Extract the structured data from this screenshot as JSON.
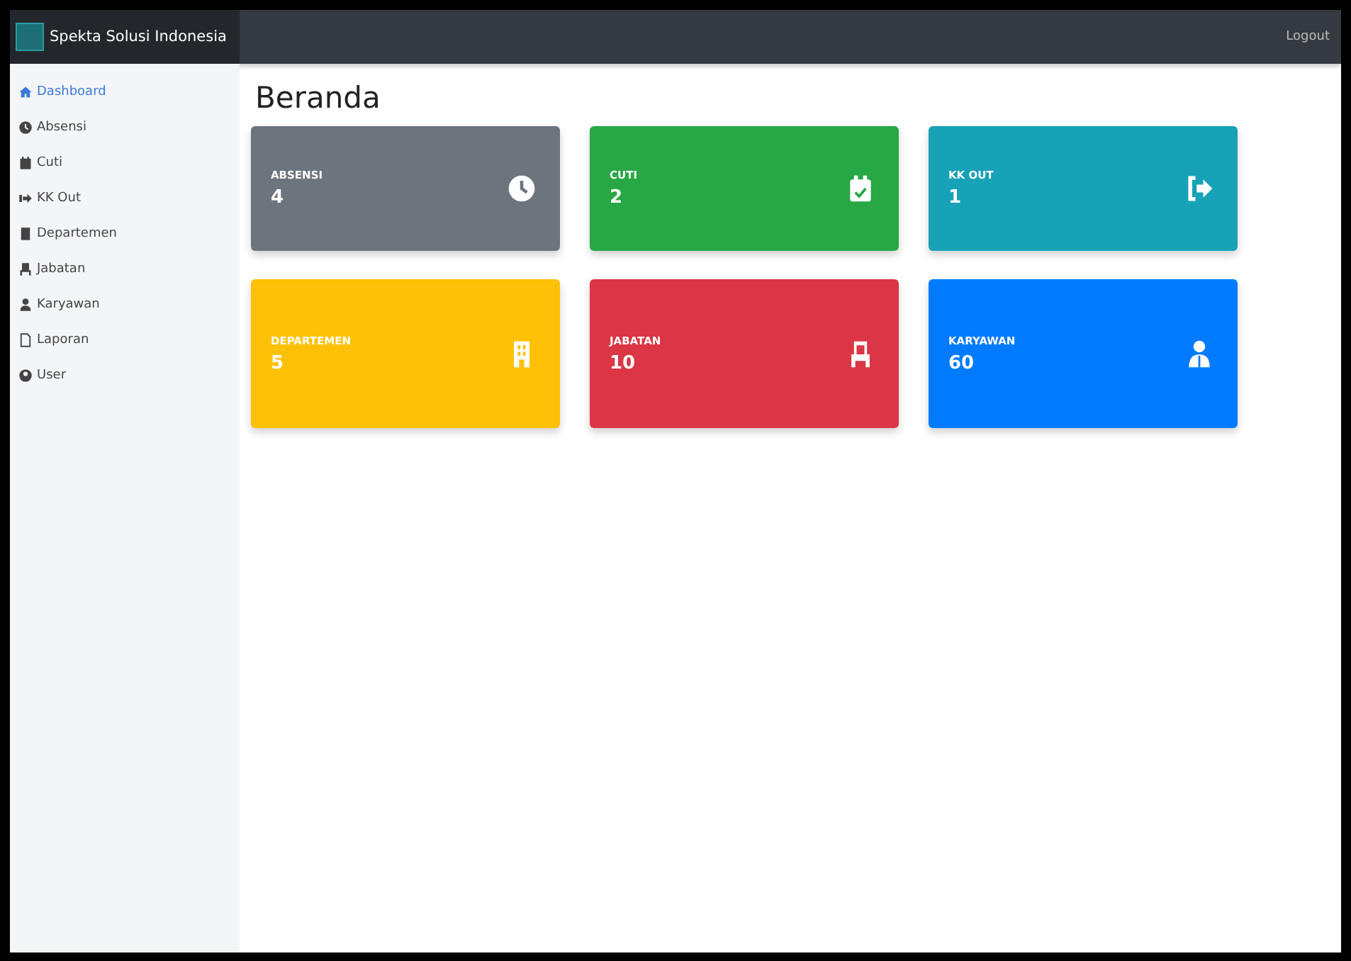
{
  "navbar": {
    "brand": "Spekta Solusi Indonesia",
    "logout": "Logout"
  },
  "sidebar": {
    "items": [
      {
        "label": "Dashboard",
        "selected": true
      },
      {
        "label": "Absensi",
        "selected": false
      },
      {
        "label": "Cuti",
        "selected": false
      },
      {
        "label": "KK Out",
        "selected": false
      },
      {
        "label": "Departemen",
        "selected": false
      },
      {
        "label": "Jabatan",
        "selected": false
      },
      {
        "label": "Karyawan",
        "selected": false
      },
      {
        "label": "Laporan",
        "selected": false
      },
      {
        "label": "User",
        "selected": false
      }
    ]
  },
  "page": {
    "title": "Beranda"
  },
  "cards": [
    {
      "label": "ABSENSI",
      "value": "4",
      "color": "#6c757d"
    },
    {
      "label": "CUTI",
      "value": "2",
      "color": "#28a745"
    },
    {
      "label": "KK OUT",
      "value": "1",
      "color": "#17a2b8"
    },
    {
      "label": "DEPARTEMEN",
      "value": "5",
      "color": "#ffc107"
    },
    {
      "label": "JABATAN",
      "value": "10",
      "color": "#dc3545"
    },
    {
      "label": "KARYAWAN",
      "value": "60",
      "color": "#007bff"
    }
  ]
}
